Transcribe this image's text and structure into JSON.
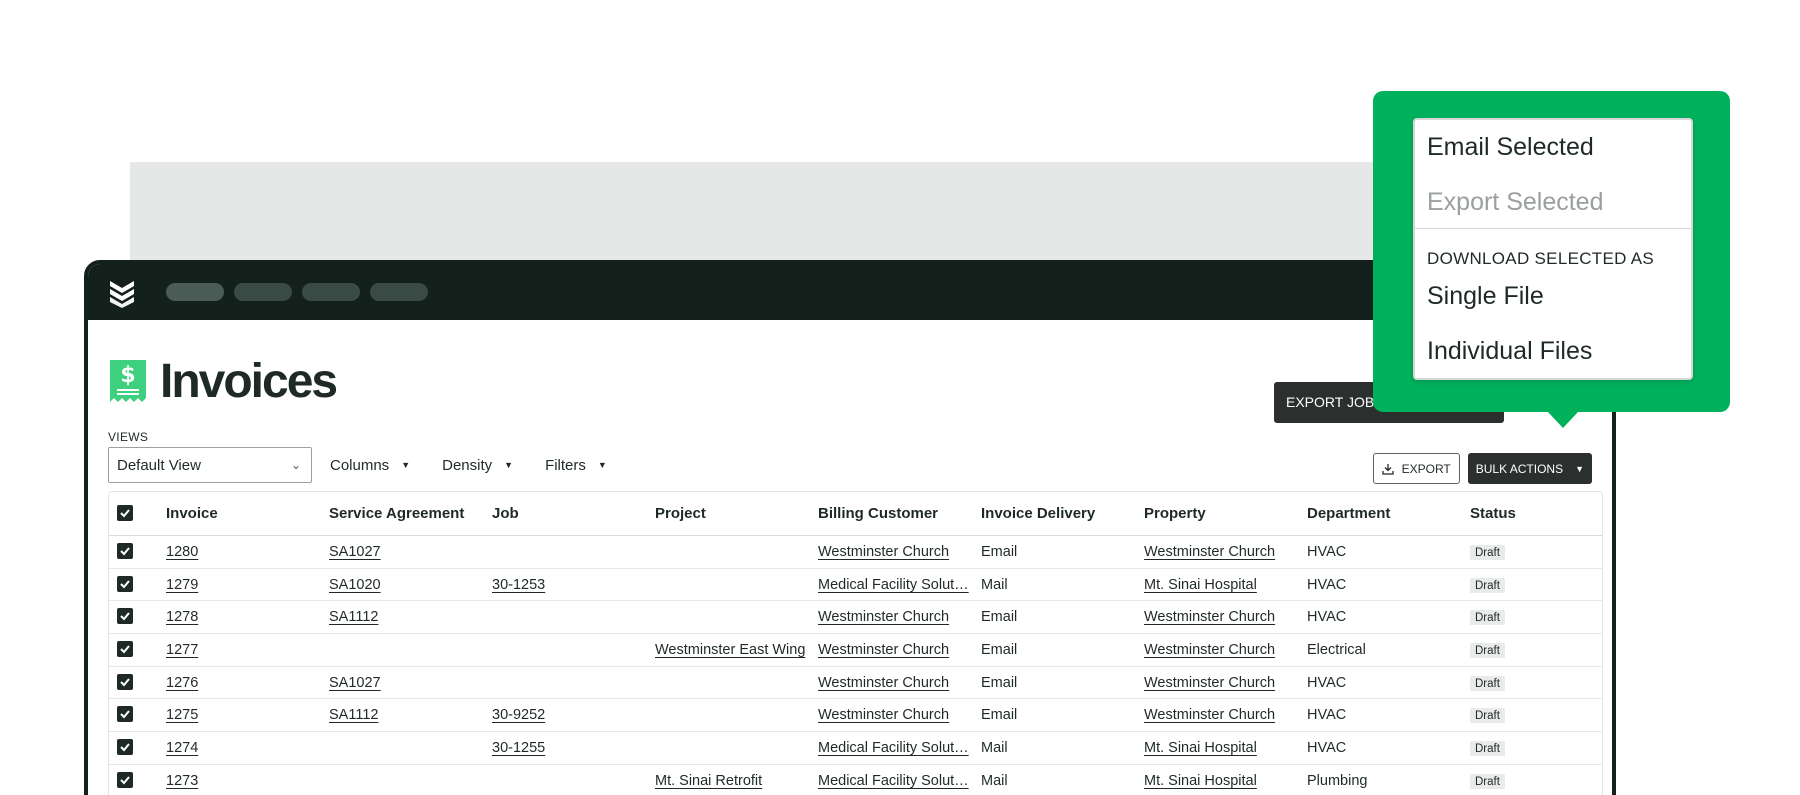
{
  "header": {
    "title": "Invoices"
  },
  "toolbar": {
    "export_jobs_label": "EXPORT JOBS",
    "views_label": "VIEWS",
    "view_value": "Default View",
    "columns_label": "Columns",
    "density_label": "Density",
    "filters_label": "Filters",
    "export_label": "EXPORT",
    "bulk_actions_label": "BULK ACTIONS"
  },
  "table": {
    "columns": [
      "Invoice",
      "Service Agreement",
      "Job",
      "Project",
      "Billing Customer",
      "Invoice Delivery",
      "Property",
      "Department",
      "Status"
    ],
    "rows": [
      {
        "invoice": "1280",
        "agreement": "SA1027",
        "job": "",
        "project": "",
        "customer": "Westminster Church",
        "delivery": "Email",
        "property": "Westminster Church",
        "department": "HVAC",
        "status": "Draft"
      },
      {
        "invoice": "1279",
        "agreement": "SA1020",
        "job": "30-1253",
        "project": "",
        "customer": "Medical Facility Solut…",
        "delivery": "Mail",
        "property": "Mt. Sinai Hospital",
        "department": "HVAC",
        "status": "Draft"
      },
      {
        "invoice": "1278",
        "agreement": "SA1112",
        "job": "",
        "project": "",
        "customer": "Westminster Church",
        "delivery": "Email",
        "property": "Westminster Church",
        "department": "HVAC",
        "status": "Draft"
      },
      {
        "invoice": "1277",
        "agreement": "",
        "job": "",
        "project": "Westminster East Wing",
        "customer": "Westminster Church",
        "delivery": "Email",
        "property": "Westminster Church",
        "department": "Electrical",
        "status": "Draft"
      },
      {
        "invoice": "1276",
        "agreement": "SA1027",
        "job": "",
        "project": "",
        "customer": "Westminster Church",
        "delivery": "Email",
        "property": "Westminster Church",
        "department": "HVAC",
        "status": "Draft"
      },
      {
        "invoice": "1275",
        "agreement": "SA1112",
        "job": "30-9252",
        "project": "",
        "customer": "Westminster Church",
        "delivery": "Email",
        "property": "Westminster Church",
        "department": "HVAC",
        "status": "Draft"
      },
      {
        "invoice": "1274",
        "agreement": "",
        "job": "30-1255",
        "project": "",
        "customer": "Medical Facility Solut…",
        "delivery": "Mail",
        "property": "Mt. Sinai Hospital",
        "department": "HVAC",
        "status": "Draft"
      },
      {
        "invoice": "1273",
        "agreement": "",
        "job": "",
        "project": "Mt. Sinai Retrofit",
        "customer": "Medical Facility Solut…",
        "delivery": "Mail",
        "property": "Mt. Sinai Hospital",
        "department": "Plumbing",
        "status": "Draft"
      }
    ]
  },
  "bulk_menu": {
    "email_selected": "Email Selected",
    "export_selected": "Export Selected",
    "download_header": "DOWNLOAD SELECTED AS",
    "single_file": "Single File",
    "individual_files": "Individual Files"
  },
  "colors": {
    "brand_green": "#00b15c",
    "dark": "#14201c",
    "icon_green": "#3fd07f"
  },
  "icons": {
    "logo": "chevrons-logo-icon",
    "invoice": "invoice-dollar-icon",
    "export": "download-icon"
  }
}
